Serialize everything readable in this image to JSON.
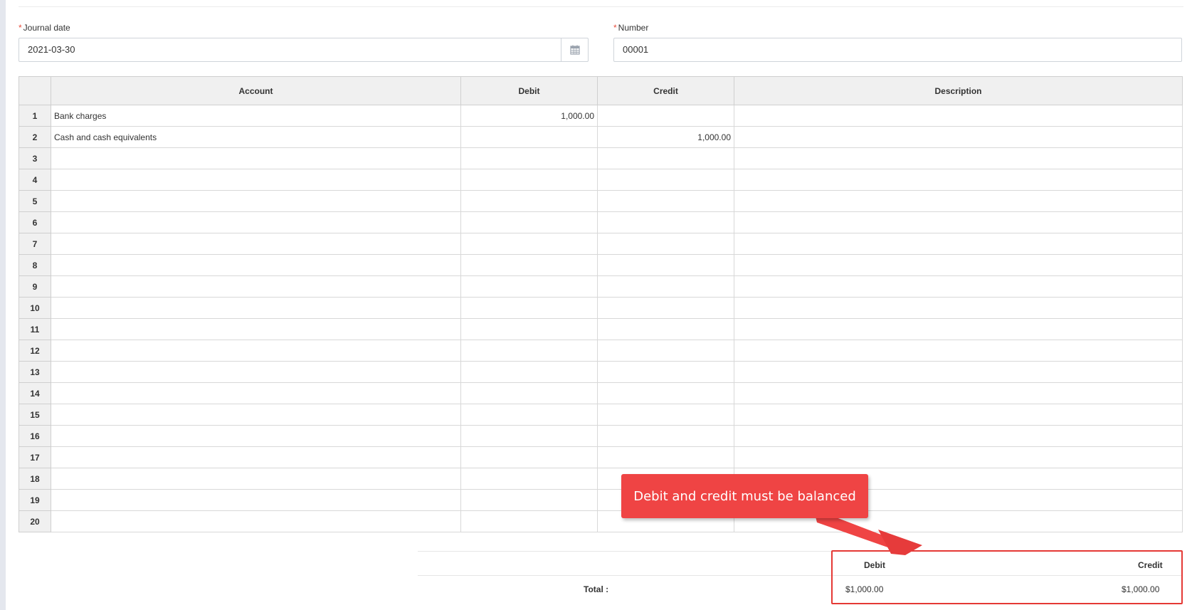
{
  "form": {
    "journal_date": {
      "label": "Journal date",
      "value": "2021-03-30",
      "required_mark": "*"
    },
    "number": {
      "label": "Number",
      "value": "00001",
      "required_mark": "*"
    }
  },
  "grid": {
    "columns": [
      "",
      "Account",
      "Debit",
      "Credit",
      "Description"
    ],
    "rows": [
      {
        "n": "1",
        "account": "Bank charges",
        "debit": "1,000.00",
        "credit": "",
        "description": ""
      },
      {
        "n": "2",
        "account": "Cash and cash equivalents",
        "debit": "",
        "credit": "1,000.00",
        "description": ""
      },
      {
        "n": "3",
        "account": "",
        "debit": "",
        "credit": "",
        "description": ""
      },
      {
        "n": "4",
        "account": "",
        "debit": "",
        "credit": "",
        "description": ""
      },
      {
        "n": "5",
        "account": "",
        "debit": "",
        "credit": "",
        "description": ""
      },
      {
        "n": "6",
        "account": "",
        "debit": "",
        "credit": "",
        "description": ""
      },
      {
        "n": "7",
        "account": "",
        "debit": "",
        "credit": "",
        "description": ""
      },
      {
        "n": "8",
        "account": "",
        "debit": "",
        "credit": "",
        "description": ""
      },
      {
        "n": "9",
        "account": "",
        "debit": "",
        "credit": "",
        "description": ""
      },
      {
        "n": "10",
        "account": "",
        "debit": "",
        "credit": "",
        "description": ""
      },
      {
        "n": "11",
        "account": "",
        "debit": "",
        "credit": "",
        "description": ""
      },
      {
        "n": "12",
        "account": "",
        "debit": "",
        "credit": "",
        "description": ""
      },
      {
        "n": "13",
        "account": "",
        "debit": "",
        "credit": "",
        "description": ""
      },
      {
        "n": "14",
        "account": "",
        "debit": "",
        "credit": "",
        "description": ""
      },
      {
        "n": "15",
        "account": "",
        "debit": "",
        "credit": "",
        "description": ""
      },
      {
        "n": "16",
        "account": "",
        "debit": "",
        "credit": "",
        "description": ""
      },
      {
        "n": "17",
        "account": "",
        "debit": "",
        "credit": "",
        "description": ""
      },
      {
        "n": "18",
        "account": "",
        "debit": "",
        "credit": "",
        "description": ""
      },
      {
        "n": "19",
        "account": "",
        "debit": "",
        "credit": "",
        "description": ""
      },
      {
        "n": "20",
        "account": "",
        "debit": "",
        "credit": "",
        "description": ""
      }
    ]
  },
  "totals": {
    "label": "Total :",
    "debit_header": "Debit",
    "credit_header": "Credit",
    "debit_value": "$1,000.00",
    "credit_value": "$1,000.00"
  },
  "annotation": {
    "text": "Debit and credit must be balanced",
    "color": "#ef4444"
  },
  "icons": {
    "date_picker": "calendar-icon"
  }
}
